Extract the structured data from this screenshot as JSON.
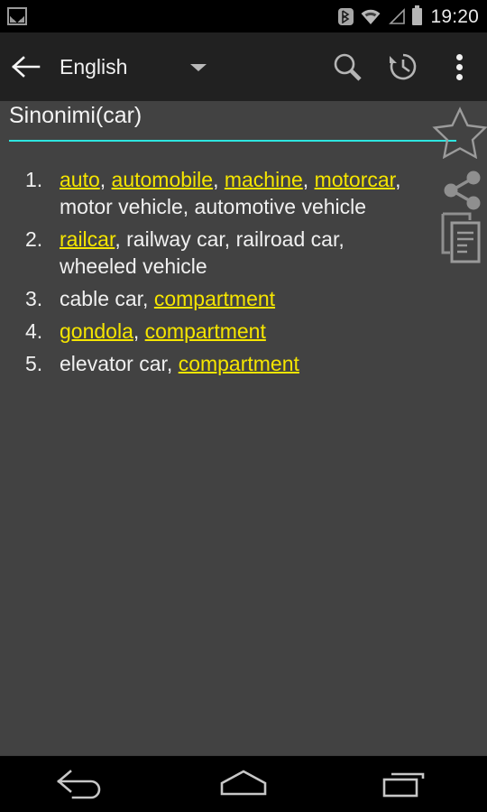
{
  "statusbar": {
    "photo_icon": "image-icon",
    "bluetooth_icon": "bluetooth-icon",
    "wifi_icon": "wifi-icon",
    "signal_icon": "signal-icon",
    "battery_icon": "battery-icon",
    "time": "19:20"
  },
  "toolbar": {
    "back_icon": "arrow-left-icon",
    "language": "English",
    "dropdown_icon": "chevron-down-icon",
    "search_icon": "search-icon",
    "history_icon": "history-icon",
    "overflow_icon": "more-vertical-icon"
  },
  "query": {
    "value": "Sinonimi(car)",
    "placeholder": "Sinonimi(car)",
    "underline_color": "#2ee6e0"
  },
  "actions": {
    "favorite_icon": "star-outline-icon",
    "share_icon": "share-icon",
    "copy_icon": "copy-icon"
  },
  "colors": {
    "link": "#f5e500",
    "text": "#f0f0f0",
    "content_bg": "#424242",
    "toolbar_bg": "#212121",
    "accent": "#2ee6e0"
  },
  "results": [
    {
      "number": "1.",
      "parts": [
        {
          "text": "auto",
          "link": true
        },
        {
          "text": ", ",
          "link": false
        },
        {
          "text": "automobile",
          "link": true
        },
        {
          "text": ", ",
          "link": false
        },
        {
          "text": "machine",
          "link": true
        },
        {
          "text": ", ",
          "link": false
        },
        {
          "text": "motorcar",
          "link": true
        },
        {
          "text": ", motor vehicle, automotive vehicle",
          "link": false
        }
      ]
    },
    {
      "number": "2.",
      "parts": [
        {
          "text": "railcar",
          "link": true
        },
        {
          "text": ", railway car, railroad car, wheeled vehicle",
          "link": false
        }
      ]
    },
    {
      "number": "3.",
      "parts": [
        {
          "text": "cable car, ",
          "link": false
        },
        {
          "text": "compartment",
          "link": true
        }
      ]
    },
    {
      "number": "4.",
      "parts": [
        {
          "text": "gondola",
          "link": true
        },
        {
          "text": ", ",
          "link": false
        },
        {
          "text": "compartment",
          "link": true
        }
      ]
    },
    {
      "number": "5.",
      "parts": [
        {
          "text": "elevator car, ",
          "link": false
        },
        {
          "text": "compartment",
          "link": true
        }
      ]
    }
  ],
  "navbar": {
    "back_icon": "nav-back-icon",
    "home_icon": "nav-home-icon",
    "recents_icon": "nav-recents-icon"
  }
}
